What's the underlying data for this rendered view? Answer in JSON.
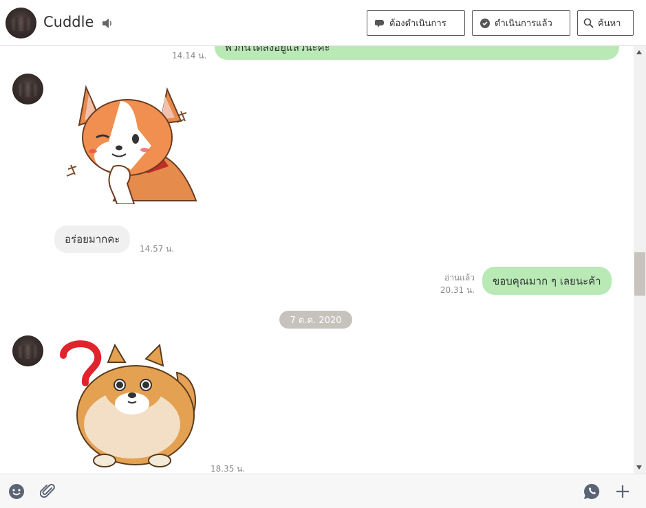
{
  "header": {
    "title": "Cuddle",
    "avatar_icon": "avatar-icon",
    "buttons": {
      "todo": "ต้องดำเนินการ",
      "done": "ดำเนินการแล้ว",
      "search": "ค้นหา"
    }
  },
  "messages": {
    "m1": {
      "text": "พวกนี้ใดส่งอยู่แล้วนะคะ",
      "time": "14.14 น."
    },
    "m2": {
      "sticker": "corgi-thinking-sticker"
    },
    "m3": {
      "text": "อร่อยมากคะ",
      "time": "14.57 น."
    },
    "m4": {
      "text": "ขอบคุณมาก ๆ เลยนะค้า",
      "read": "อ่านแล้ว",
      "time": "20.31 น."
    },
    "date_separator": "7 ต.ค. 2020",
    "m5": {
      "sticker": "pomeranian-question-sticker",
      "time": "18.35 น."
    }
  },
  "colors": {
    "outgoing_bubble": "#b9eab6",
    "incoming_bubble": "#f0f0f0",
    "date_pill": "#c6c3bd"
  }
}
